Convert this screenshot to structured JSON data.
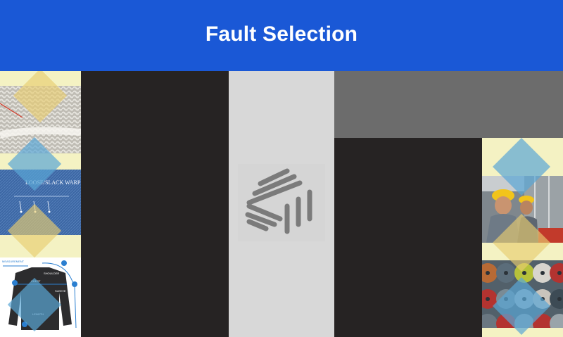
{
  "header": {
    "title": "Fault Selection"
  },
  "left_column": {
    "items": [
      {
        "name": "knit-fabric-fault",
        "icon": "knit-fabric-image"
      },
      {
        "name": "loose-slack-warp-fault",
        "label": "LOOSE/SLACK WARP",
        "icon": "denim-fabric-image"
      },
      {
        "name": "shirt-measurement",
        "labels": [
          "MEASUREMENT",
          "SHOULDER",
          "CHEST",
          "SLEEVE",
          "LENGTH"
        ],
        "icon": "shirt-diagram-image"
      }
    ]
  },
  "right_column": {
    "items": [
      {
        "name": "factory-workers",
        "icon": "factory-workers-image"
      },
      {
        "name": "yarn-spools",
        "icon": "yarn-spools-image"
      }
    ]
  },
  "center": {
    "icon": "loading-logo-icon"
  },
  "colors": {
    "header_bg": "#1a58d6",
    "panel_dark": "#262323",
    "panel_light": "#d8d8d8",
    "panel_gray": "#6c6c6c",
    "strip_bg": "#f4f2c3",
    "diamond_blue": "#5aa6d6",
    "diamond_yellow": "#e8cc70"
  }
}
